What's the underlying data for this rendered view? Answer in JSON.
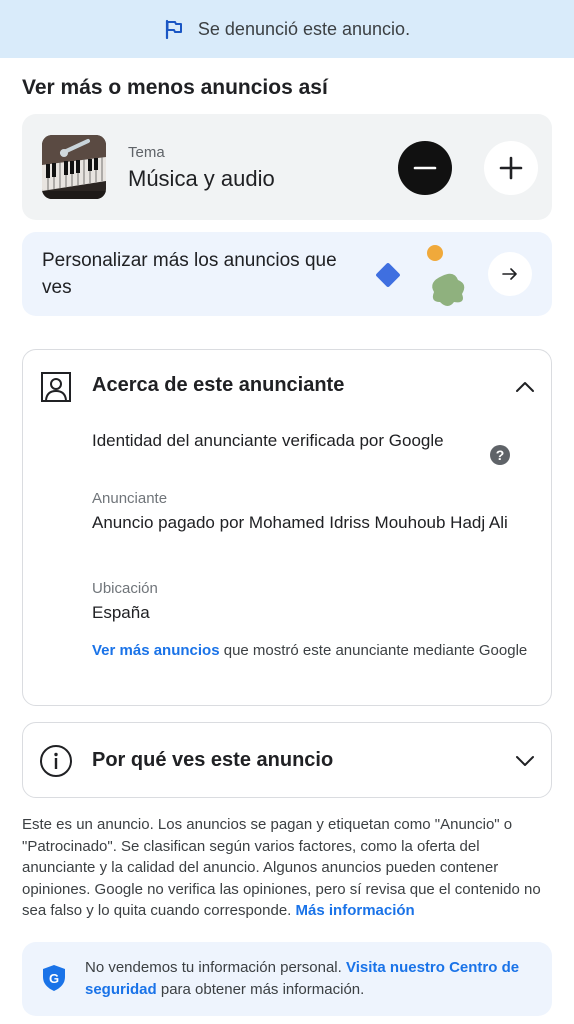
{
  "banner": {
    "text": "Se denunció este anuncio.",
    "icon": "flag-icon"
  },
  "section_title": "Ver más o menos anuncios así",
  "topic": {
    "label": "Tema",
    "value": "Música y audio",
    "decrease_icon": "minus-icon",
    "increase_icon": "plus-icon"
  },
  "personalize": {
    "text": "Personalizar más los anuncios que ves",
    "arrow_icon": "arrow-right-icon"
  },
  "about": {
    "title": "Acerca de este anunciante",
    "verified_text": "Identidad del anunciante verificada por Google",
    "advertiser_label": "Anunciante",
    "advertiser_value": "Anuncio pagado por Mohamed Idriss Mouhoub Hadj Ali",
    "location_label": "Ubicación",
    "location_value": "España",
    "more_ads_link": "Ver más anuncios",
    "more_ads_rest": " que mostró este anunciante mediante Google"
  },
  "why": {
    "title": "Por qué ves este anuncio"
  },
  "disclaimer": {
    "text": "Este es un anuncio. Los anuncios se pagan y etiquetan como \"Anuncio\" o \"Patrocinado\". Se clasifican según varios factores, como la oferta del anunciante y la calidad del anuncio. Algunos anuncios pueden contener opiniones. Google no verifica las opiniones, pero sí revisa que el contenido no sea falso y lo quita cuando corresponde. ",
    "link": "Más información"
  },
  "privacy": {
    "text": "No vendemos tu información personal. ",
    "link": "Visita nuestro Centro de seguridad",
    "rest": " para obtener más información."
  },
  "colors": {
    "banner_bg": "#d9ebfa",
    "card_gray": "#f1f3f4",
    "card_blue": "#eef4fd",
    "link": "#1a73e8",
    "flag": "#1a56c4"
  }
}
